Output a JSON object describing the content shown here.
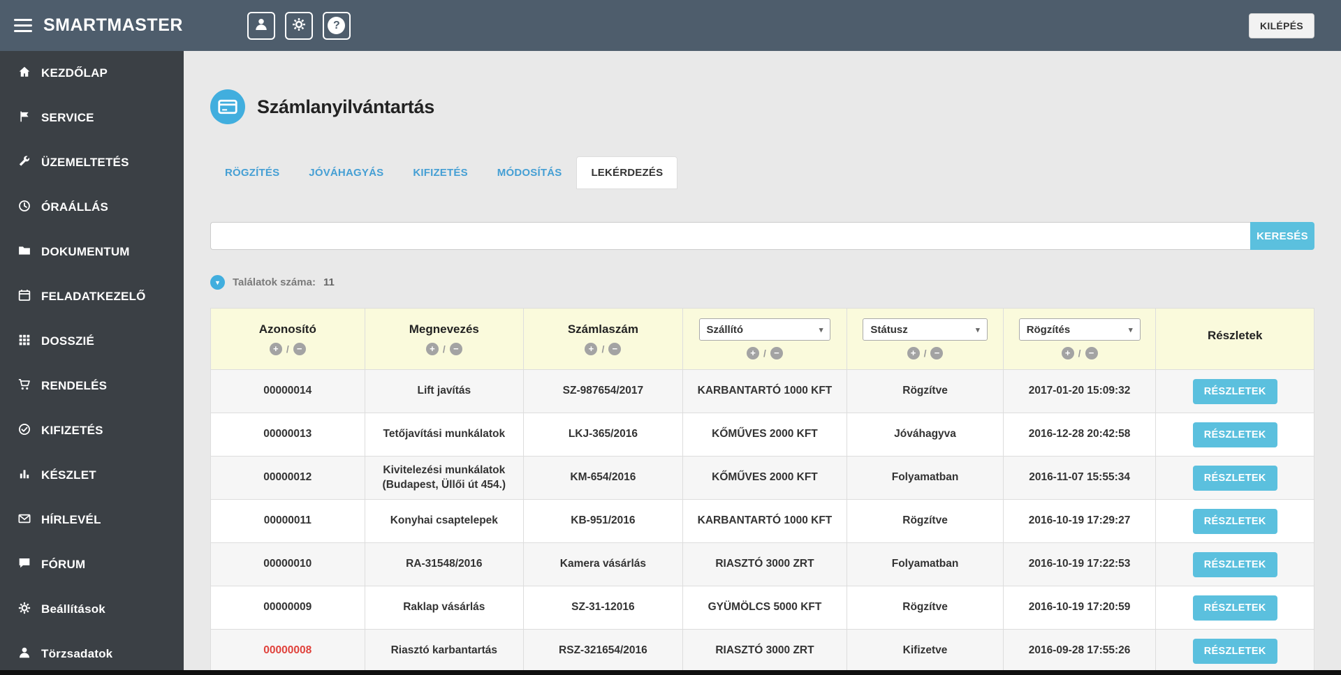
{
  "topbar": {
    "brand": "SMARTMASTER",
    "logout_label": "KILÉPÉS"
  },
  "icons": {
    "plus": "+",
    "minus": "−",
    "slash": "/",
    "caret": "▾",
    "question": "?",
    "results_arrow": "▼"
  },
  "sidebar": {
    "items": [
      {
        "label": "KEZDŐLAP",
        "icon": "home-icon"
      },
      {
        "label": "SERVICE",
        "icon": "flag-icon"
      },
      {
        "label": "ÜZEMELTETÉS",
        "icon": "wrench-icon"
      },
      {
        "label": "ÓRAÁLLÁS",
        "icon": "clock-icon"
      },
      {
        "label": "DOKUMENTUM",
        "icon": "folder-icon"
      },
      {
        "label": "FELADATKEZELŐ",
        "icon": "calendar-icon"
      },
      {
        "label": "DOSSZIÉ",
        "icon": "grid-icon"
      },
      {
        "label": "RENDELÉS",
        "icon": "cart-icon"
      },
      {
        "label": "KIFIZETÉS",
        "icon": "check-circle-icon"
      },
      {
        "label": "KÉSZLET",
        "icon": "bar-chart-icon"
      },
      {
        "label": "HÍRLEVÉL",
        "icon": "mail-icon"
      },
      {
        "label": "FÓRUM",
        "icon": "chat-icon"
      },
      {
        "label": "Beállítások",
        "icon": "gear-icon"
      },
      {
        "label": "Törzsadatok",
        "icon": "users-icon"
      }
    ]
  },
  "page": {
    "title": "Számlanyilvántartás",
    "tabs": [
      {
        "label": "RÖGZÍTÉS"
      },
      {
        "label": "JÓVÁHAGYÁS"
      },
      {
        "label": "KIFIZETÉS"
      },
      {
        "label": "MÓDOSÍTÁS"
      },
      {
        "label": "LEKÉRDEZÉS"
      }
    ],
    "active_tab": "LEKÉRDEZÉS",
    "search": {
      "value": "",
      "placeholder": "",
      "button_label": "KERESÉS"
    },
    "results": {
      "label": "Találatok száma:",
      "count": "11"
    }
  },
  "table": {
    "columns": {
      "id": "Azonosító",
      "name": "Megnevezés",
      "invoice": "Számlaszám",
      "details": "Részletek"
    },
    "filters": {
      "supplier": "Szállító",
      "status": "Státusz",
      "recorded": "Rögzítés"
    },
    "details_label": "RÉSZLETEK",
    "rows": [
      {
        "id": "00000014",
        "name": "Lift javítás",
        "invoice": "SZ-987654/2017",
        "supplier": "KARBANTARTÓ 1000 KFT",
        "status": "Rögzítve",
        "recorded": "2017-01-20 15:09:32"
      },
      {
        "id": "00000013",
        "name": "Tetőjavítási munkálatok",
        "invoice": "LKJ-365/2016",
        "supplier": "KŐMŰVES 2000 KFT",
        "status": "Jóváhagyva",
        "recorded": "2016-12-28 20:42:58"
      },
      {
        "id": "00000012",
        "name": "Kivitelezési munkálatok (Budapest, Üllői út 454.)",
        "invoice": "KM-654/2016",
        "supplier": "KŐMŰVES 2000 KFT",
        "status": "Folyamatban",
        "recorded": "2016-11-07 15:55:34"
      },
      {
        "id": "00000011",
        "name": "Konyhai csaptelepek",
        "invoice": "KB-951/2016",
        "supplier": "KARBANTARTÓ 1000 KFT",
        "status": "Rögzítve",
        "recorded": "2016-10-19 17:29:27"
      },
      {
        "id": "00000010",
        "name": "RA-31548/2016",
        "invoice": "Kamera vásárlás",
        "supplier": "RIASZTÓ 3000 ZRT",
        "status": "Folyamatban",
        "recorded": "2016-10-19 17:22:53"
      },
      {
        "id": "00000009",
        "name": "Raklap vásárlás",
        "invoice": "SZ-31-12016",
        "supplier": "GYÜMÖLCS 5000 KFT",
        "status": "Rögzítve",
        "recorded": "2016-10-19 17:20:59"
      },
      {
        "id": "00000008",
        "name": "Riasztó karbantartás",
        "invoice": "RSZ-321654/2016",
        "supplier": "RIASZTÓ 3000 ZRT",
        "status": "Kifizetve",
        "recorded": "2016-09-28 17:55:26"
      }
    ]
  },
  "colors": {
    "topbar": "#4e5d6c",
    "sidebar": "#3b4045",
    "accent": "#5bc0de",
    "hdr_yellow": "#fafadc",
    "tab_blue": "#459fd4",
    "red": "#e0423c",
    "title_icon": "#41aede"
  }
}
